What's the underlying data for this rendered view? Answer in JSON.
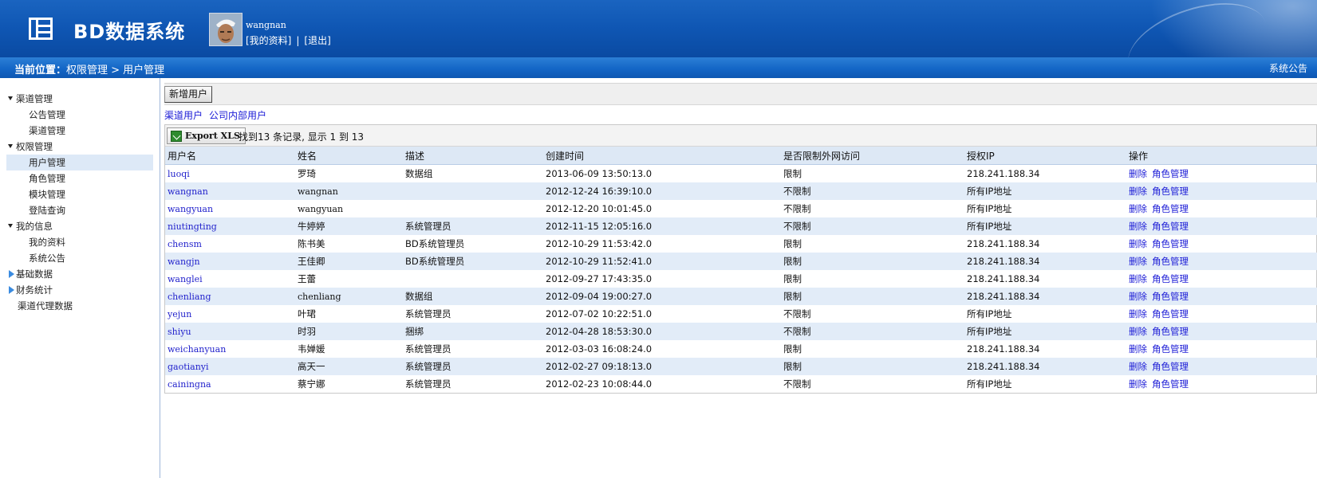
{
  "header": {
    "app_title": "BD数据系统",
    "username": "wangnan",
    "my_profile_link": "[我的资料]",
    "separator": "|",
    "logout_link": "[退出]"
  },
  "breadcrumb": {
    "label": "当前位置：",
    "path": "权限管理 > 用户管理",
    "notice": "系统公告"
  },
  "sidebar": {
    "items": [
      {
        "label": "渠道管理",
        "type": "group"
      },
      {
        "label": "公告管理",
        "type": "child"
      },
      {
        "label": "渠道管理",
        "type": "child"
      },
      {
        "label": "权限管理",
        "type": "group"
      },
      {
        "label": "用户管理",
        "type": "child",
        "active": true
      },
      {
        "label": "角色管理",
        "type": "child"
      },
      {
        "label": "模块管理",
        "type": "child"
      },
      {
        "label": "登陆查询",
        "type": "child"
      },
      {
        "label": "我的信息",
        "type": "group"
      },
      {
        "label": "我的资料",
        "type": "child"
      },
      {
        "label": "系统公告",
        "type": "child"
      },
      {
        "label": "基础数据",
        "type": "collapsed"
      },
      {
        "label": "财务统计",
        "type": "collapsed"
      },
      {
        "label": "渠道代理数据",
        "type": "leaf"
      }
    ]
  },
  "toolbar": {
    "add_user": "新增用户"
  },
  "tabs": [
    "渠道用户",
    "公司内部用户"
  ],
  "pager": {
    "export_label": "Export XLS",
    "summary": "找到13 条记录, 显示 1 到 13"
  },
  "table": {
    "columns": [
      "用户名",
      "姓名",
      "描述",
      "创建时间",
      "是否限制外网访问",
      "授权IP",
      "操作"
    ],
    "rows": [
      [
        "luoqi",
        "罗琦",
        "数据组",
        "2013-06-09 13:50:13.0",
        "限制",
        "218.241.188.34"
      ],
      [
        "wangnan",
        "wangnan",
        "",
        "2012-12-24 16:39:10.0",
        "不限制",
        "所有IP地址"
      ],
      [
        "wangyuan",
        "wangyuan",
        "",
        "2012-12-20 10:01:45.0",
        "不限制",
        "所有IP地址"
      ],
      [
        "niutingting",
        "牛婷婷",
        "系统管理员",
        "2012-11-15 12:05:16.0",
        "不限制",
        "所有IP地址"
      ],
      [
        "chensm",
        "陈书美",
        "BD系统管理员",
        "2012-10-29 11:53:42.0",
        "限制",
        "218.241.188.34"
      ],
      [
        "wangjn",
        "王佳卿",
        "BD系统管理员",
        "2012-10-29 11:52:41.0",
        "限制",
        "218.241.188.34"
      ],
      [
        "wanglei",
        "王蕾",
        "",
        "2012-09-27 17:43:35.0",
        "限制",
        "218.241.188.34"
      ],
      [
        "chenliang",
        "chenliang",
        "数据组",
        "2012-09-04 19:00:27.0",
        "限制",
        "218.241.188.34"
      ],
      [
        "yejun",
        "叶珺",
        "系统管理员",
        "2012-07-02 10:22:51.0",
        "不限制",
        "所有IP地址"
      ],
      [
        "shiyu",
        "时羽",
        "捆绑",
        "2012-04-28 18:53:30.0",
        "不限制",
        "所有IP地址"
      ],
      [
        "weichanyuan",
        "韦婵媛",
        "系统管理员",
        "2012-03-03 16:08:24.0",
        "限制",
        "218.241.188.34"
      ],
      [
        "gaotianyi",
        "高天一",
        "系统管理员",
        "2012-02-27 09:18:13.0",
        "限制",
        "218.241.188.34"
      ],
      [
        "cainingna",
        "蔡宁娜",
        "系统管理员",
        "2012-02-23 10:08:44.0",
        "不限制",
        "所有IP地址"
      ]
    ],
    "actions": [
      "删除",
      "角色管理"
    ]
  },
  "icons": {
    "logo": "grid-logo-icon",
    "expanded": "triangle-down-icon",
    "collapsed": "arrow-right-icon",
    "export": "excel-icon"
  },
  "colors": {
    "header_blue": "#0f56b3",
    "link_blue": "#1a1ad6",
    "row_alt": "#e2ecf8"
  }
}
